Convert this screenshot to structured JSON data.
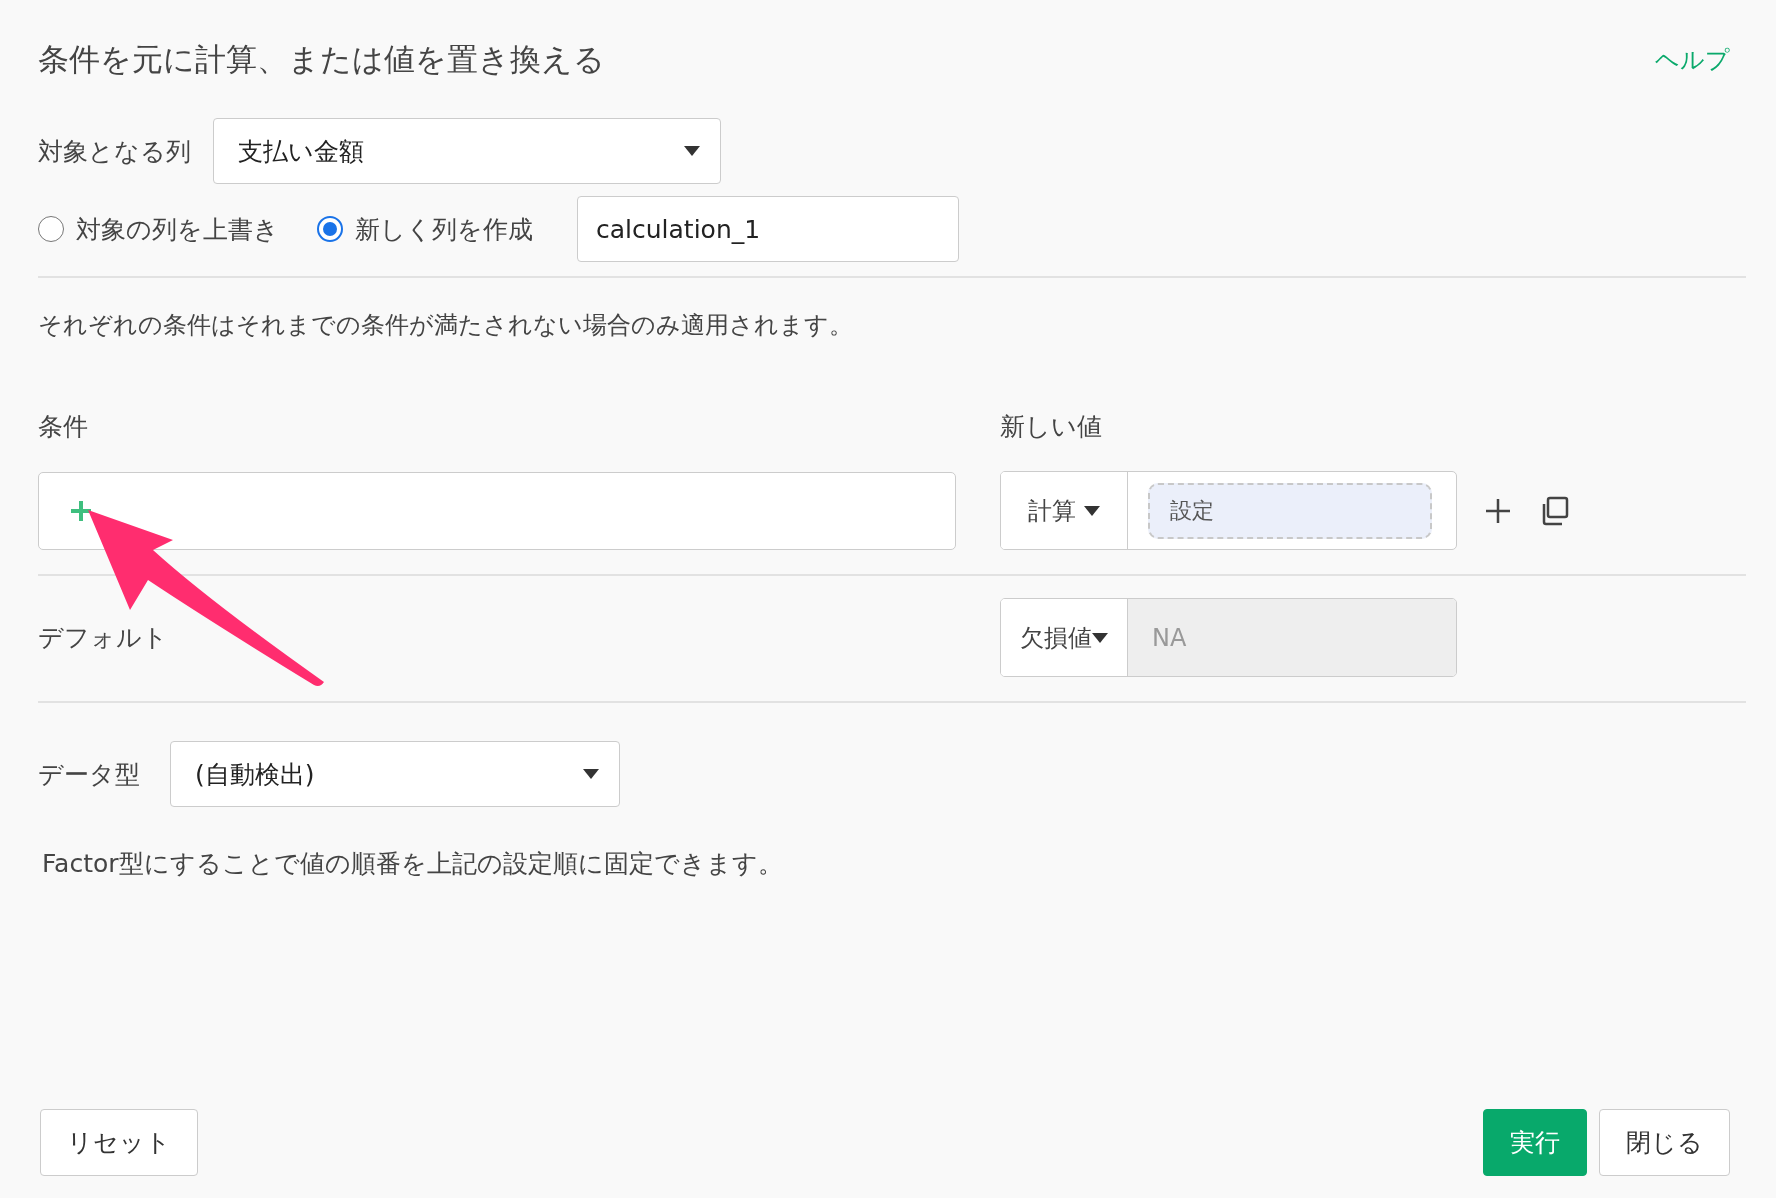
{
  "title": "条件を元に計算、または値を置き換える",
  "help_link": "ヘルプ",
  "target_column": {
    "label": "対象となる列",
    "value": "支払い金額"
  },
  "output_mode": [
    {
      "label": "対象の列を上書き",
      "selected": false
    },
    {
      "label": "新しく列を作成",
      "selected": true
    }
  ],
  "new_column_name": {
    "value": "calculation_1"
  },
  "note": "それぞれの条件はそれまでの条件が満たされない場合のみ適用されます。",
  "conditions_header": "条件",
  "new_value_header": "新しい値",
  "condition_row": {
    "value_type": "計算",
    "value_button": "設定"
  },
  "default": {
    "label": "デフォルト",
    "value_type": "欠損値",
    "value": "NA"
  },
  "data_type": {
    "label": "データ型",
    "value": "(自動検出)"
  },
  "factor_note": "Factor型にすることで値の順番を上記の設定順に固定できます。",
  "buttons": [
    {
      "kind": "secondary",
      "label": "リセット"
    },
    {
      "kind": "primary",
      "label": "実行"
    },
    {
      "kind": "secondary",
      "label": "閉じる"
    }
  ]
}
